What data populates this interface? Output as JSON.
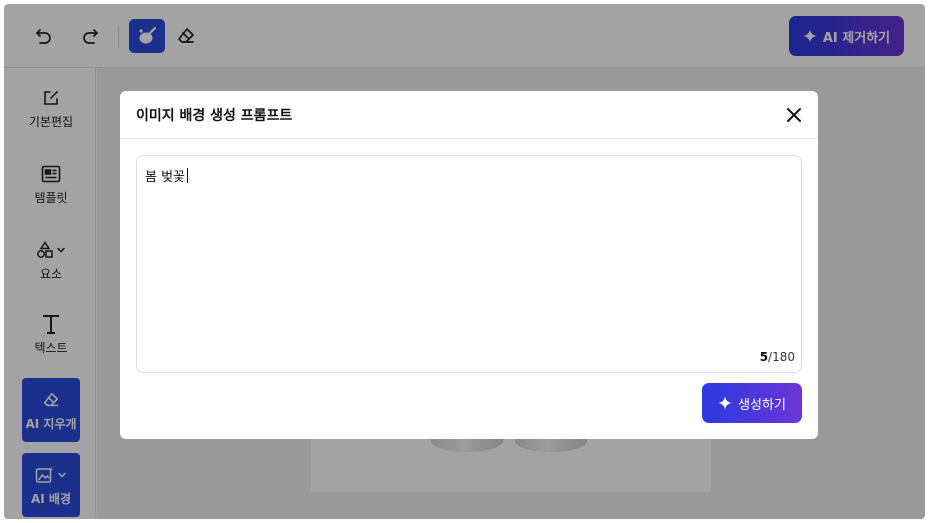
{
  "toolbar": {
    "undo_icon": "undo-icon",
    "redo_icon": "redo-icon",
    "brush_icon": "brush-icon",
    "eraser_icon": "eraser-icon",
    "ai_remove_label": "AI 제거하기"
  },
  "sidebar": {
    "items": [
      {
        "label": "기본편집",
        "icon": "edit-square-icon"
      },
      {
        "label": "템플릿",
        "icon": "template-icon"
      },
      {
        "label": "요소",
        "icon": "shapes-icon"
      },
      {
        "label": "텍스트",
        "icon": "text-icon"
      },
      {
        "label": "AI 지우개",
        "icon": "eraser-icon"
      },
      {
        "label": "AI 배경",
        "icon": "ai-image-icon"
      }
    ]
  },
  "modal": {
    "title": "이미지 배경 생성 프롬프트",
    "prompt_value": "봄 벚꽃",
    "char_count": "5",
    "char_max": "/180",
    "generate_label": "생성하기"
  },
  "colors": {
    "accent": "#2b4cdc",
    "gradient_start": "#2a3ae0",
    "gradient_end": "#6d35d6"
  }
}
